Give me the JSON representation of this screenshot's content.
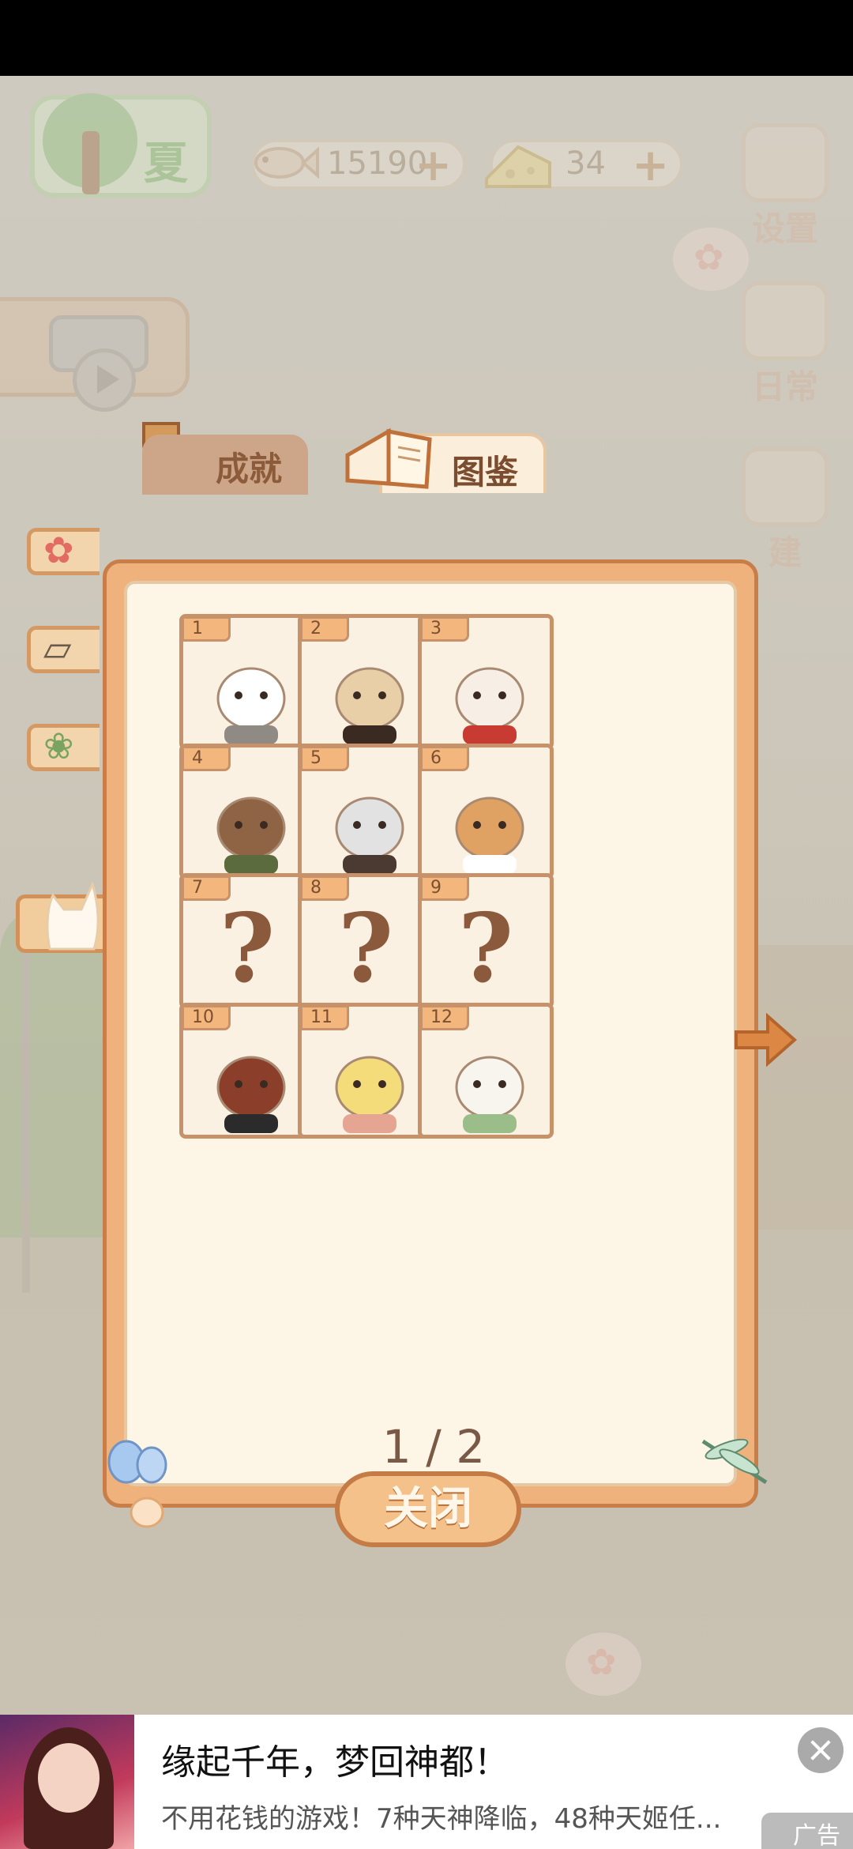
{
  "hud": {
    "season_label": "夏",
    "fish_currency": "15190",
    "cheese_currency": "34",
    "plus_symbol": "+",
    "settings_label": "设置",
    "daily_label": "日常",
    "build_label": "建"
  },
  "tabs": {
    "achievements_label": "成就",
    "atlas_label": "图鉴",
    "active": "atlas"
  },
  "side_categories": [
    "flower",
    "postcard",
    "bouquet",
    "cat"
  ],
  "cards": [
    {
      "number": "1",
      "unlocked": true,
      "animal": "gray cat"
    },
    {
      "number": "2",
      "unlocked": true,
      "animal": "mouse with top hat"
    },
    {
      "number": "3",
      "unlocked": true,
      "animal": "rabbit"
    },
    {
      "number": "4",
      "unlocked": true,
      "animal": "bear"
    },
    {
      "number": "5",
      "unlocked": true,
      "animal": "raccoon"
    },
    {
      "number": "6",
      "unlocked": true,
      "animal": "shiba dog"
    },
    {
      "number": "7",
      "unlocked": false,
      "placeholder": "?"
    },
    {
      "number": "8",
      "unlocked": false,
      "placeholder": "?"
    },
    {
      "number": "9",
      "unlocked": false,
      "placeholder": "?"
    },
    {
      "number": "10",
      "unlocked": true,
      "animal": "crow in hood"
    },
    {
      "number": "11",
      "unlocked": true,
      "animal": "alpaca"
    },
    {
      "number": "12",
      "unlocked": true,
      "animal": "white fox"
    }
  ],
  "pagination": {
    "indicator": "1 / 2"
  },
  "close_label": "关闭",
  "ad": {
    "title": "缘起千年，梦回神都！",
    "description": "不用花钱的游戏！7种天神降临，48种天姬任...",
    "tag": "广告"
  },
  "colors": {
    "panel_border": "#c97d48",
    "panel_fill": "#f0b27d",
    "inner_fill": "#fdf6e6",
    "accent_brown": "#8b5a3d"
  }
}
